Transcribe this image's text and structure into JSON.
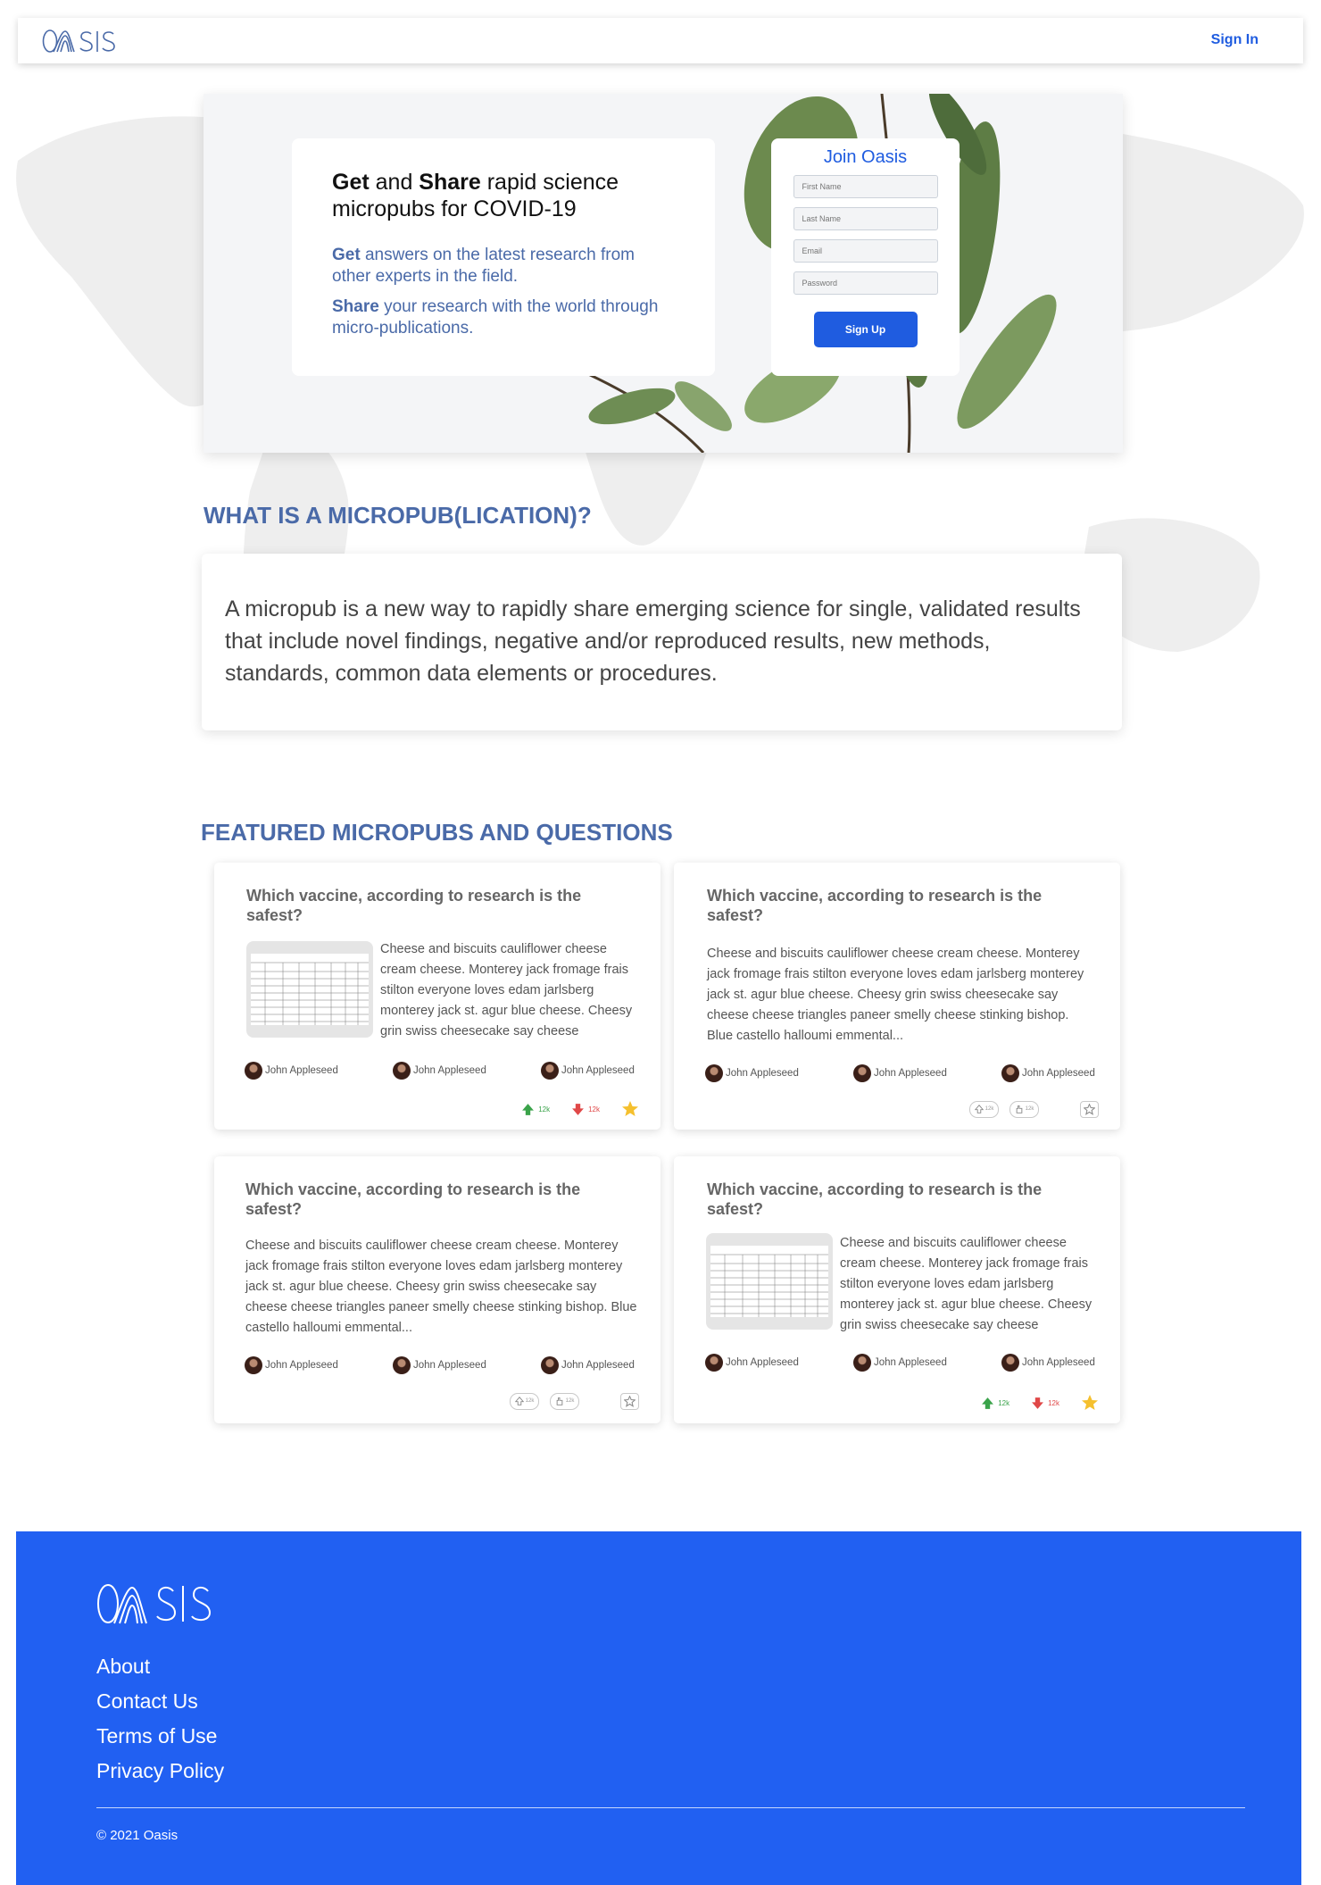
{
  "header": {
    "logo_text": "OASIS",
    "signin_label": "Sign In"
  },
  "hero": {
    "title_bold_1": "Get",
    "title_and": " and ",
    "title_bold_2": "Share",
    "title_rest": " rapid science micropubs for COVID-19",
    "get_bold": "Get",
    "get_text": " answers on the latest research from other experts in the field.",
    "share_bold": "Share",
    "share_text": " your research with the world through micro-publications."
  },
  "join": {
    "title": "Join Oasis",
    "first_name_placeholder": "First Name",
    "last_name_placeholder": "Last Name",
    "email_placeholder": "Email",
    "password_placeholder": "Password",
    "signup_label": "Sign Up"
  },
  "what": {
    "heading": "WHAT IS A MICROPUB(LICATION)?",
    "text": "A micropub is a new way to rapidly share emerging science for single, validated results that include novel findings, negative and/or reproduced results, new methods, standards, common data elements or procedures."
  },
  "featured": {
    "heading": "FEATURED MICROPUBS AND QUESTIONS",
    "cards": [
      {
        "title": "Which vaccine, according to research is the safest?",
        "body": "Cheese and biscuits cauliflower cheese cream cheese. Monterey jack fromage frais stilton everyone loves edam jarlsberg monterey jack st. agur blue cheese. Cheesy grin swiss cheesecake say cheese",
        "authors": [
          "John Appleseed",
          "John Appleseed",
          "John Appleseed"
        ],
        "upvotes": "12k",
        "downvotes": "12k"
      },
      {
        "title": "Which vaccine, according to research is the safest?",
        "body": "Cheese and biscuits cauliflower cheese cream cheese. Monterey jack fromage frais stilton everyone loves edam jarlsberg monterey jack st. agur blue cheese. Cheesy grin swiss cheesecake say cheese cheese triangles paneer smelly cheese stinking bishop. Blue castello halloumi emmental...",
        "authors": [
          "John Appleseed",
          "John Appleseed",
          "John Appleseed"
        ],
        "upvotes": "12k",
        "downvotes": "12k"
      },
      {
        "title": "Which vaccine, according to research is the safest?",
        "body": "Cheese and biscuits cauliflower cheese cream cheese. Monterey jack fromage frais stilton everyone loves edam jarlsberg monterey jack st. agur blue cheese. Cheesy grin swiss cheesecake say cheese cheese triangles paneer smelly cheese stinking bishop. Blue castello halloumi emmental...",
        "authors": [
          "John Appleseed",
          "John Appleseed",
          "John Appleseed"
        ],
        "upvotes": "12k",
        "downvotes": "12k"
      },
      {
        "title": "Which vaccine, according to research is the safest?",
        "body": "Cheese and biscuits cauliflower cheese cream cheese. Monterey jack fromage frais stilton everyone loves edam jarlsberg monterey jack st. agur blue cheese. Cheesy grin swiss cheesecake say cheese",
        "authors": [
          "John Appleseed",
          "John Appleseed",
          "John Appleseed"
        ],
        "upvotes": "12k",
        "downvotes": "12k"
      }
    ]
  },
  "footer": {
    "logo_text": "OASIS",
    "links": [
      "About",
      "Contact Us",
      "Terms of Use",
      "Privacy Policy"
    ],
    "copyright": "© 2021 Oasis"
  },
  "colors": {
    "brand_blue": "#2160f2",
    "heading_blue": "#4a6aa8",
    "upvote_green": "#3aa34a",
    "downvote_red": "#e04848",
    "star_yellow": "#f5c02e"
  }
}
